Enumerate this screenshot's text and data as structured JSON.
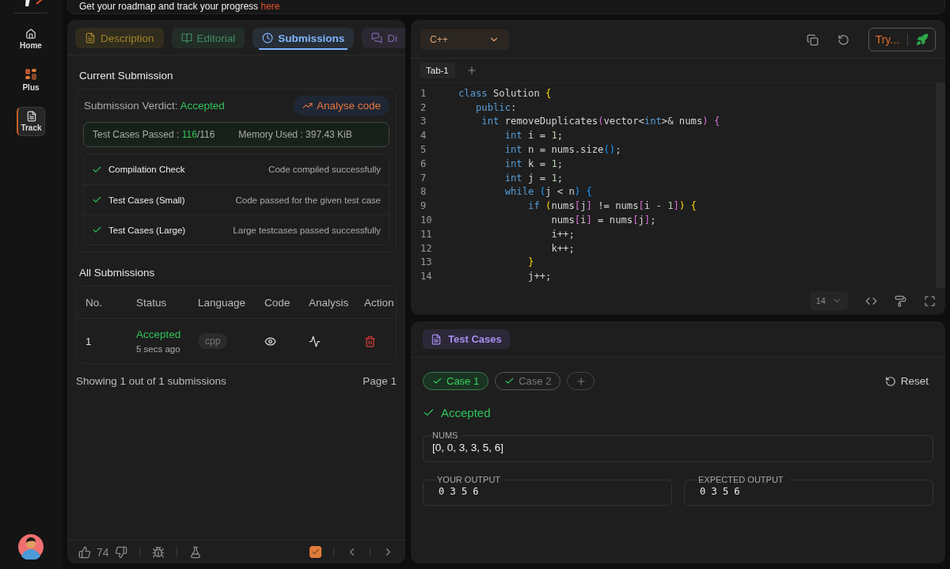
{
  "banner": {
    "text": "Get your roadmap and track your progress",
    "link": "here"
  },
  "sidebar": {
    "items": [
      {
        "label": "Home",
        "selected": false
      },
      {
        "label": "Plus",
        "selected": false
      },
      {
        "label": "Track",
        "selected": true
      }
    ]
  },
  "problem_tabs": [
    {
      "label": "Description",
      "selected": false
    },
    {
      "label": "Editorial",
      "selected": false
    },
    {
      "label": "Submissions",
      "selected": true
    },
    {
      "label": "Di",
      "selected": false
    }
  ],
  "current_submission": {
    "title": "Current Submission",
    "verdict_label": "Submission Verdict:",
    "verdict": "Accepted",
    "analyse_button": "Analyse code",
    "passed_label": "Test Cases Passed :",
    "passed": "116",
    "total": "/116",
    "memory": "Memory Used : 397.43 KiB",
    "checks": [
      {
        "name": "Compilation Check",
        "detail": "Code compiled successfully",
        "passed": true
      },
      {
        "name": "Test Cases (Small)",
        "detail": "Code passed for the given test case",
        "passed": true
      },
      {
        "name": "Test Cases (Large)",
        "detail": "Large testcases passed successfully",
        "passed": true
      }
    ]
  },
  "all_submissions": {
    "title": "All Submissions",
    "columns": [
      "No.",
      "Status",
      "Language",
      "Code",
      "Analysis",
      "Action"
    ],
    "rows": [
      {
        "no": "1",
        "status": "Accepted",
        "time": "5 secs ago",
        "language": "cpp"
      }
    ],
    "summary": "Showing 1 out of 1 submissions",
    "page": "Page 1"
  },
  "footer": {
    "likes": "74",
    "solved": true
  },
  "editor": {
    "language": "C++",
    "run_button": "Try...",
    "tabs": [
      {
        "label": "Tab-1",
        "selected": true
      }
    ],
    "font_size": "14",
    "lines": [
      {
        "number": "1",
        "tokens": [
          {
            "text": "class",
            "kind": "keyword"
          },
          {
            "text": " Solution ",
            "kind": "plain"
          },
          {
            "text": "{",
            "kind": "gold"
          }
        ]
      },
      {
        "number": "2",
        "tokens": [
          {
            "text": "   public",
            "kind": "keyword"
          },
          {
            "text": ":",
            "kind": "plain"
          }
        ]
      },
      {
        "number": "3",
        "tokens": [
          {
            "text": "    int",
            "kind": "keyword"
          },
          {
            "text": " removeDuplicates",
            "kind": "plain"
          },
          {
            "text": "(",
            "kind": "violet"
          },
          {
            "text": "vector<",
            "kind": "plain"
          },
          {
            "text": "int",
            "kind": "keyword"
          },
          {
            "text": ">& nums",
            "kind": "plain"
          },
          {
            "text": ")",
            "kind": "violet"
          },
          {
            "text": " {",
            "kind": "violet"
          }
        ]
      },
      {
        "number": "4",
        "tokens": [
          {
            "text": "        int",
            "kind": "keyword"
          },
          {
            "text": " i = ",
            "kind": "plain"
          },
          {
            "text": "1",
            "kind": "number"
          },
          {
            "text": ";",
            "kind": "plain"
          }
        ]
      },
      {
        "number": "5",
        "tokens": [
          {
            "text": "        int",
            "kind": "keyword"
          },
          {
            "text": " n = nums.size",
            "kind": "plain"
          },
          {
            "text": "()",
            "kind": "azure"
          },
          {
            "text": ";",
            "kind": "plain"
          }
        ]
      },
      {
        "number": "6",
        "tokens": [
          {
            "text": "        int",
            "kind": "keyword"
          },
          {
            "text": " k = ",
            "kind": "plain"
          },
          {
            "text": "1",
            "kind": "number"
          },
          {
            "text": ";",
            "kind": "plain"
          }
        ]
      },
      {
        "number": "7",
        "tokens": [
          {
            "text": "        int",
            "kind": "keyword"
          },
          {
            "text": " j = ",
            "kind": "plain"
          },
          {
            "text": "1",
            "kind": "number"
          },
          {
            "text": ";",
            "kind": "plain"
          }
        ]
      },
      {
        "number": "8",
        "tokens": [
          {
            "text": "        while",
            "kind": "keyword"
          },
          {
            "text": " (",
            "kind": "azure"
          },
          {
            "text": "j < n",
            "kind": "plain"
          },
          {
            "text": ") {",
            "kind": "azure"
          }
        ]
      },
      {
        "number": "9",
        "tokens": [
          {
            "text": "            if",
            "kind": "keyword"
          },
          {
            "text": " (",
            "kind": "gold"
          },
          {
            "text": "nums",
            "kind": "plain"
          },
          {
            "text": "[",
            "kind": "violet"
          },
          {
            "text": "j",
            "kind": "plain"
          },
          {
            "text": "]",
            "kind": "violet"
          },
          {
            "text": " != nums",
            "kind": "plain"
          },
          {
            "text": "[",
            "kind": "violet"
          },
          {
            "text": "i - ",
            "kind": "plain"
          },
          {
            "text": "1",
            "kind": "number"
          },
          {
            "text": "]",
            "kind": "violet"
          },
          {
            "text": ") {",
            "kind": "gold"
          }
        ]
      },
      {
        "number": "10",
        "tokens": [
          {
            "text": "                nums",
            "kind": "plain"
          },
          {
            "text": "[",
            "kind": "violet"
          },
          {
            "text": "i",
            "kind": "plain"
          },
          {
            "text": "]",
            "kind": "violet"
          },
          {
            "text": " = nums",
            "kind": "plain"
          },
          {
            "text": "[",
            "kind": "violet"
          },
          {
            "text": "j",
            "kind": "plain"
          },
          {
            "text": "]",
            "kind": "violet"
          },
          {
            "text": ";",
            "kind": "plain"
          }
        ]
      },
      {
        "number": "11",
        "tokens": [
          {
            "text": "                i++;",
            "kind": "plain"
          }
        ]
      },
      {
        "number": "12",
        "tokens": [
          {
            "text": "                k++;",
            "kind": "plain"
          }
        ]
      },
      {
        "number": "13",
        "tokens": [
          {
            "text": "            }",
            "kind": "gold"
          }
        ]
      },
      {
        "number": "14",
        "tokens": [
          {
            "text": "            j++;",
            "kind": "plain"
          }
        ]
      }
    ]
  },
  "test_cases": {
    "title": "Test Cases",
    "reset_button": "Reset",
    "cases": [
      {
        "label": "Case 1",
        "passed": true,
        "selected": true
      },
      {
        "label": "Case 2",
        "passed": true,
        "selected": false
      }
    ],
    "verdict": "Accepted",
    "input_label": "NUMS",
    "input_value": "[0, 0, 3, 3, 5, 6]",
    "output_label": "YOUR OUTPUT",
    "output_value": "0 3 5 6",
    "expected_label": "EXPECTED OUTPUT",
    "expected_value": "0 3 5 6"
  }
}
